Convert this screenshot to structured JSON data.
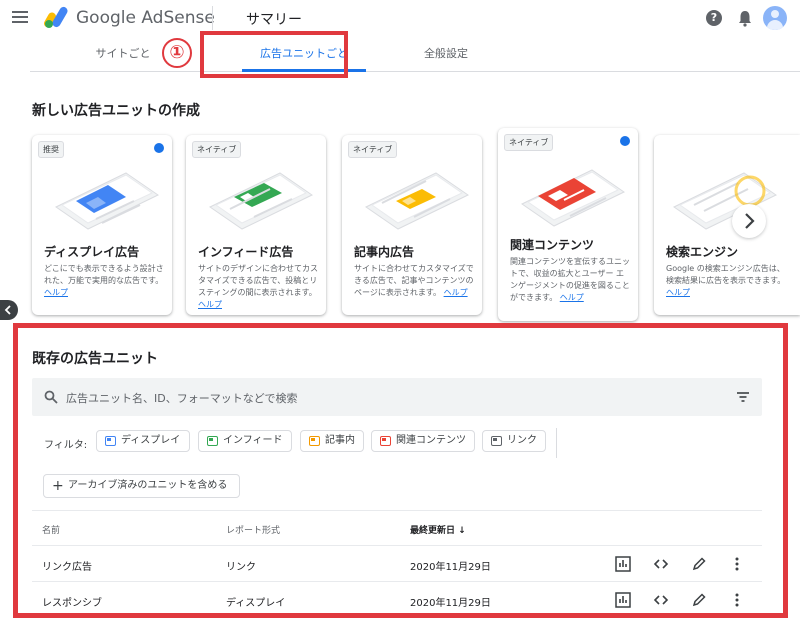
{
  "header": {
    "brand": "Google AdSense",
    "page_title": "サマリー",
    "help": "?"
  },
  "tabs": [
    {
      "label": "サイトごと"
    },
    {
      "label": "広告ユニットごと",
      "active": true
    },
    {
      "label": "全般設定"
    }
  ],
  "annotation": {
    "number": "①",
    "color": "#e0393e"
  },
  "create_section": {
    "title": "新しい広告ユニットの作成",
    "cards": [
      {
        "badge": "推奨",
        "title": "ディスプレイ広告",
        "desc": "どこにでも表示できるよう設計された、万能で実用的な広告です。",
        "help": "ヘルプ",
        "accent": "#4285f4"
      },
      {
        "badge": "ネイティブ",
        "title": "インフィード広告",
        "desc": "サイトのデザインに合わせてカスタマイズできる広告で、投稿とリスティングの間に表示されます。",
        "help": "ヘルプ",
        "accent": "#34a853"
      },
      {
        "badge": "ネイティブ",
        "title": "記事内広告",
        "desc": "サイトに合わせてカスタマイズできる広告で、記事やコンテンツのページに表示されます。",
        "help": "ヘルプ",
        "accent": "#fbbc04"
      },
      {
        "badge": "ネイティブ",
        "title": "関連コンテンツ",
        "desc": "関連コンテンツを宣伝するユニットで、収益の拡大とユーザー エンゲージメントの促進を図ることができます。",
        "help": "ヘルプ",
        "accent": "#ea4335"
      },
      {
        "badge": "",
        "title": "検索エンジン",
        "desc": "Google の検索エンジン広告は、検索結果に広告を表示できます。",
        "help": "ヘルプ",
        "accent": "#fbbc04"
      }
    ]
  },
  "existing_section": {
    "title": "既存の広告ユニット",
    "search_placeholder": "広告ユニット名、ID、フォーマットなどで検索",
    "filter_label": "フィルタ:",
    "filters": [
      {
        "label": "ディスプレイ",
        "color": "#4285f4"
      },
      {
        "label": "インフィード",
        "color": "#34a853"
      },
      {
        "label": "記事内",
        "color": "#f29900"
      },
      {
        "label": "関連コンテンツ",
        "color": "#ea4335"
      },
      {
        "label": "リンク",
        "color": "#5f6368"
      }
    ],
    "archive_button": "アーカイブ済みのユニットを含める",
    "columns": {
      "name": "名前",
      "report_format": "レポート形式",
      "last_updated": "最終更新日",
      "sort_arrow": "↓"
    },
    "rows": [
      {
        "name": "リンク広告",
        "format": "リンク",
        "date": "2020年11月29日"
      },
      {
        "name": "レスポンシブ",
        "format": "ディスプレイ",
        "date": "2020年11月29日"
      }
    ]
  }
}
